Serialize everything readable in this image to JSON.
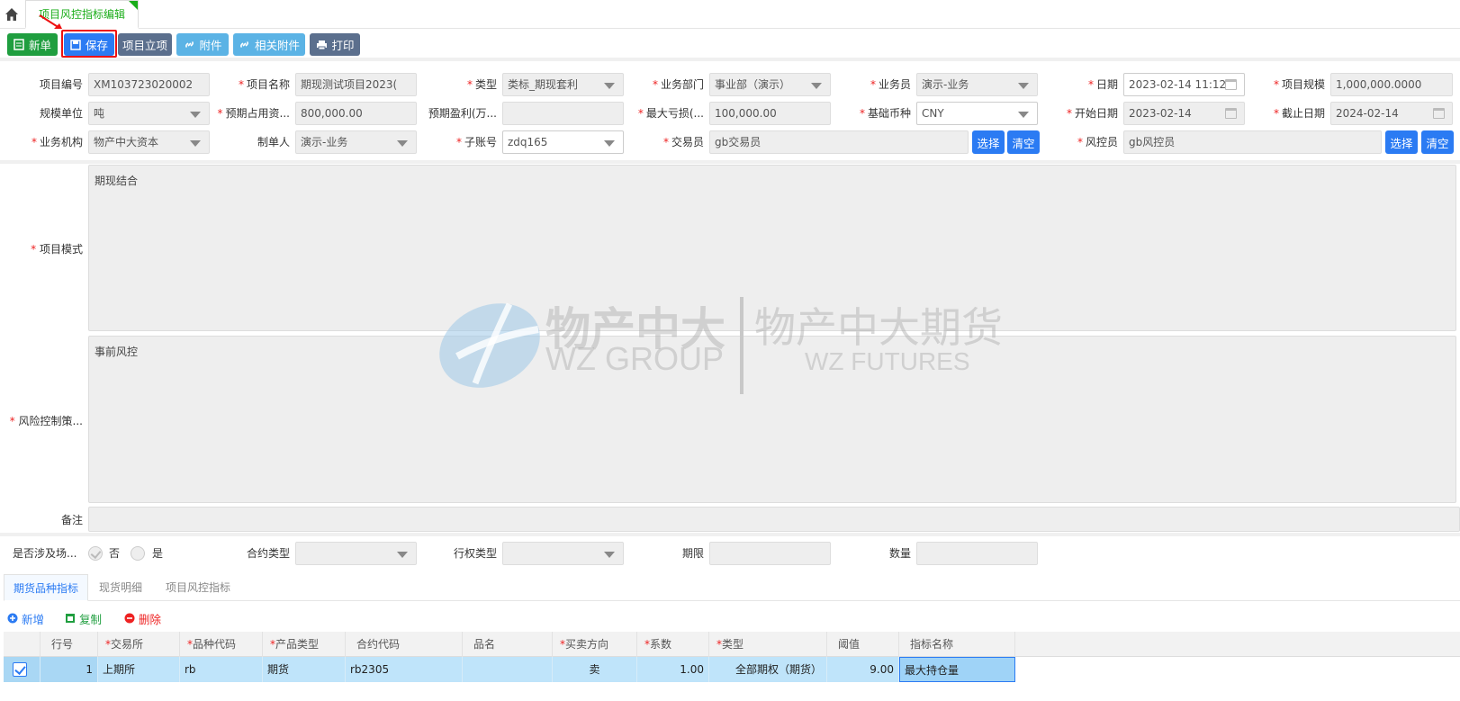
{
  "tab": {
    "title": "项目风控指标编辑"
  },
  "toolbar": {
    "new": "新单",
    "save": "保存",
    "project": "项目立项",
    "attach": "附件",
    "related": "相关附件",
    "print": "打印"
  },
  "form": {
    "row1": {
      "project_no_label": "项目编号",
      "project_no": "XM103723020002",
      "project_name_label": "项目名称",
      "project_name": "期现测试项目2023(",
      "type_label": "类型",
      "type": "类标_期现套利",
      "dept_label": "业务部门",
      "dept": "事业部（演示）",
      "salesman_label": "业务员",
      "salesman": "演示-业务",
      "date_label": "日期",
      "date": "2023-02-14 11:12",
      "scale_label": "项目规模",
      "scale": "1,000,000.0000"
    },
    "row2": {
      "unit_label": "规模单位",
      "unit": "吨",
      "funds_label": "预期占用资...",
      "funds": "800,000.00",
      "profit_label": "预期盈利(万...",
      "profit": "",
      "maxloss_label": "最大亏损(...",
      "maxloss": "100,000.00",
      "currency_label": "基础币种",
      "currency": "CNY",
      "start_label": "开始日期",
      "start": "2023-02-14",
      "end_label": "截止日期",
      "end": "2024-02-14"
    },
    "row3": {
      "org_label": "业务机构",
      "org": "物产中大资本",
      "maker_label": "制单人",
      "maker": "演示-业务",
      "sub_label": "子账号",
      "sub": "zdq165",
      "trader_label": "交易员",
      "trader": "gb交易员",
      "risk_label": "风控员",
      "risk": "gb风控员",
      "select": "选择",
      "clear": "清空"
    },
    "mode_label": "项目模式",
    "mode": "期现结合",
    "strategy_label": "风险控制策...",
    "strategy": "事前风控",
    "remark_label": "备注",
    "remark": ""
  },
  "options": {
    "spot_label": "是否涉及场...",
    "no": "否",
    "yes": "是",
    "contract_type_label": "合约类型",
    "exercise_label": "行权类型",
    "term_label": "期限",
    "qty_label": "数量"
  },
  "subtabs": [
    "期货品种指标",
    "现货明细",
    "项目风控指标"
  ],
  "actions": {
    "add": "新增",
    "copy": "复制",
    "delete": "删除"
  },
  "grid": {
    "headers": [
      "行号",
      "交易所",
      "品种代码",
      "产品类型",
      "合约代码",
      "品名",
      "买卖方向",
      "系数",
      "类型",
      "阈值",
      "指标名称"
    ],
    "rows": [
      {
        "no": "1",
        "exchange": "上期所",
        "code": "rb",
        "product": "期货",
        "contract": "rb2305",
        "name": "",
        "side": "卖",
        "coef": "1.00",
        "type": "全部期权（期货）",
        "threshold": "9.00",
        "indicator": "最大持仓量"
      }
    ]
  },
  "watermark": {
    "cn_left": "物产中大",
    "en_left": "WZ GROUP",
    "cn_right": "物产中大期货",
    "en_right": "WZ FUTURES"
  },
  "colors": {
    "green": "#1f9e3f",
    "blue": "#2b7bf3",
    "slate": "#5b6f8d",
    "sky": "#5bb3e5",
    "row": "#bfe4fa"
  }
}
